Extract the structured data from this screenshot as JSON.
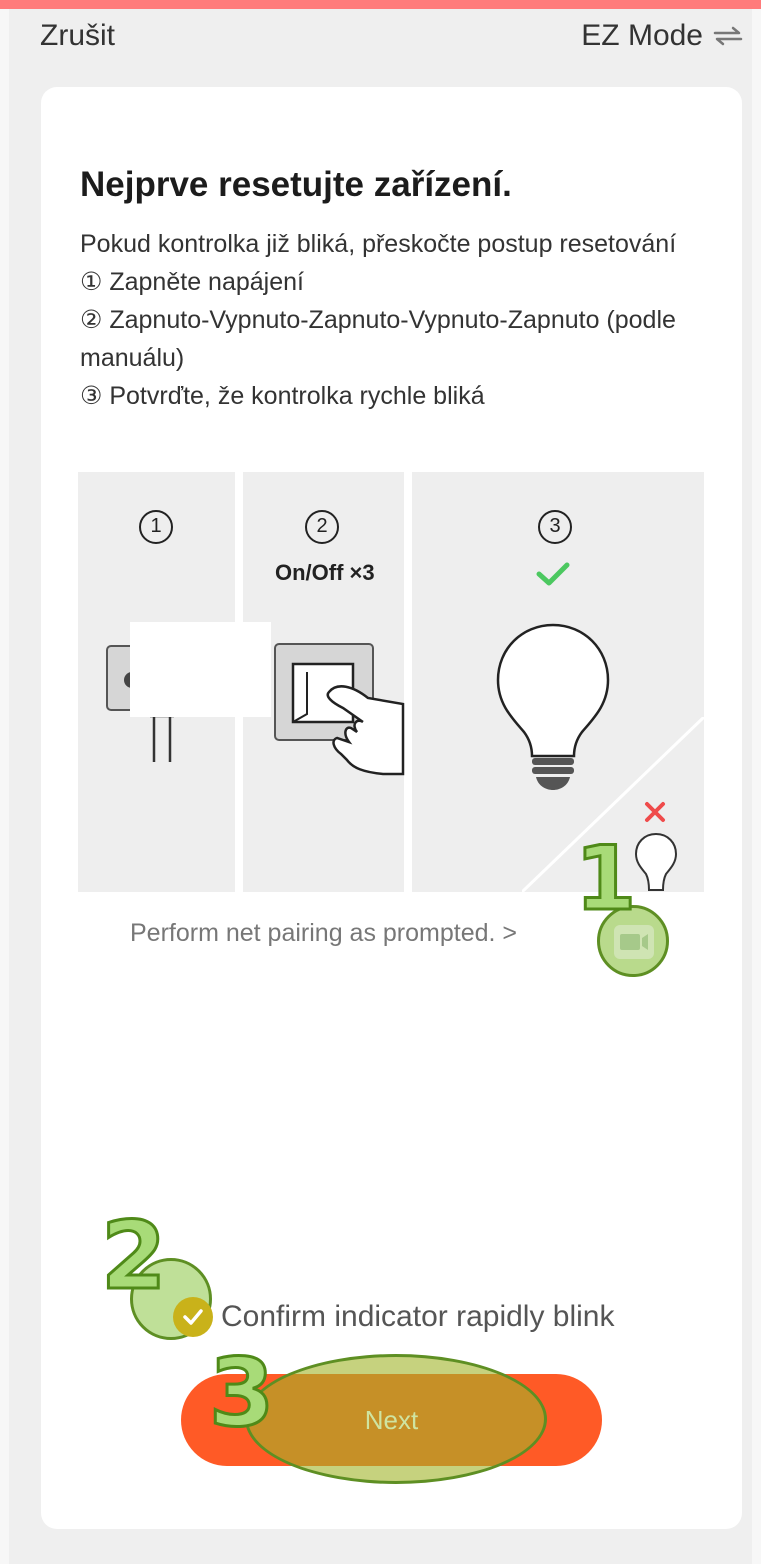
{
  "header": {
    "cancel_label": "Zrušit",
    "mode_label": "EZ Mode"
  },
  "main": {
    "title": "Nejprve resetujte zařízení.",
    "description_lines": [
      "Pokud kontrolka již bliká, přeskočte postup resetování",
      "① Zapněte napájení",
      "② Zapnuto-Vypnuto-Zapnuto-Vypnuto-Zapnuto (podle manuálu)",
      "③ Potvrďte, že kontrolka rychle bliká"
    ],
    "illustration": {
      "step1_num": "1",
      "step2_num": "2",
      "step2_caption": "On/Off ×3",
      "step3_num": "3"
    },
    "net_pairing_link": "Perform net pairing as prompted. >",
    "confirm_label": "Confirm indicator rapidly blink",
    "next_label": "Next"
  },
  "annotations": {
    "marker1": "1",
    "marker2": "2",
    "marker3": "3"
  },
  "colors": {
    "accent": "#ff5a26",
    "top_bar": "#ff7b7b",
    "annotation_fill": "#a8db78",
    "annotation_stroke": "#4f8a18"
  },
  "icons": [
    "swap-arrows-icon",
    "check-icon",
    "cross-icon",
    "video-icon",
    "checkmark-circle-icon"
  ]
}
